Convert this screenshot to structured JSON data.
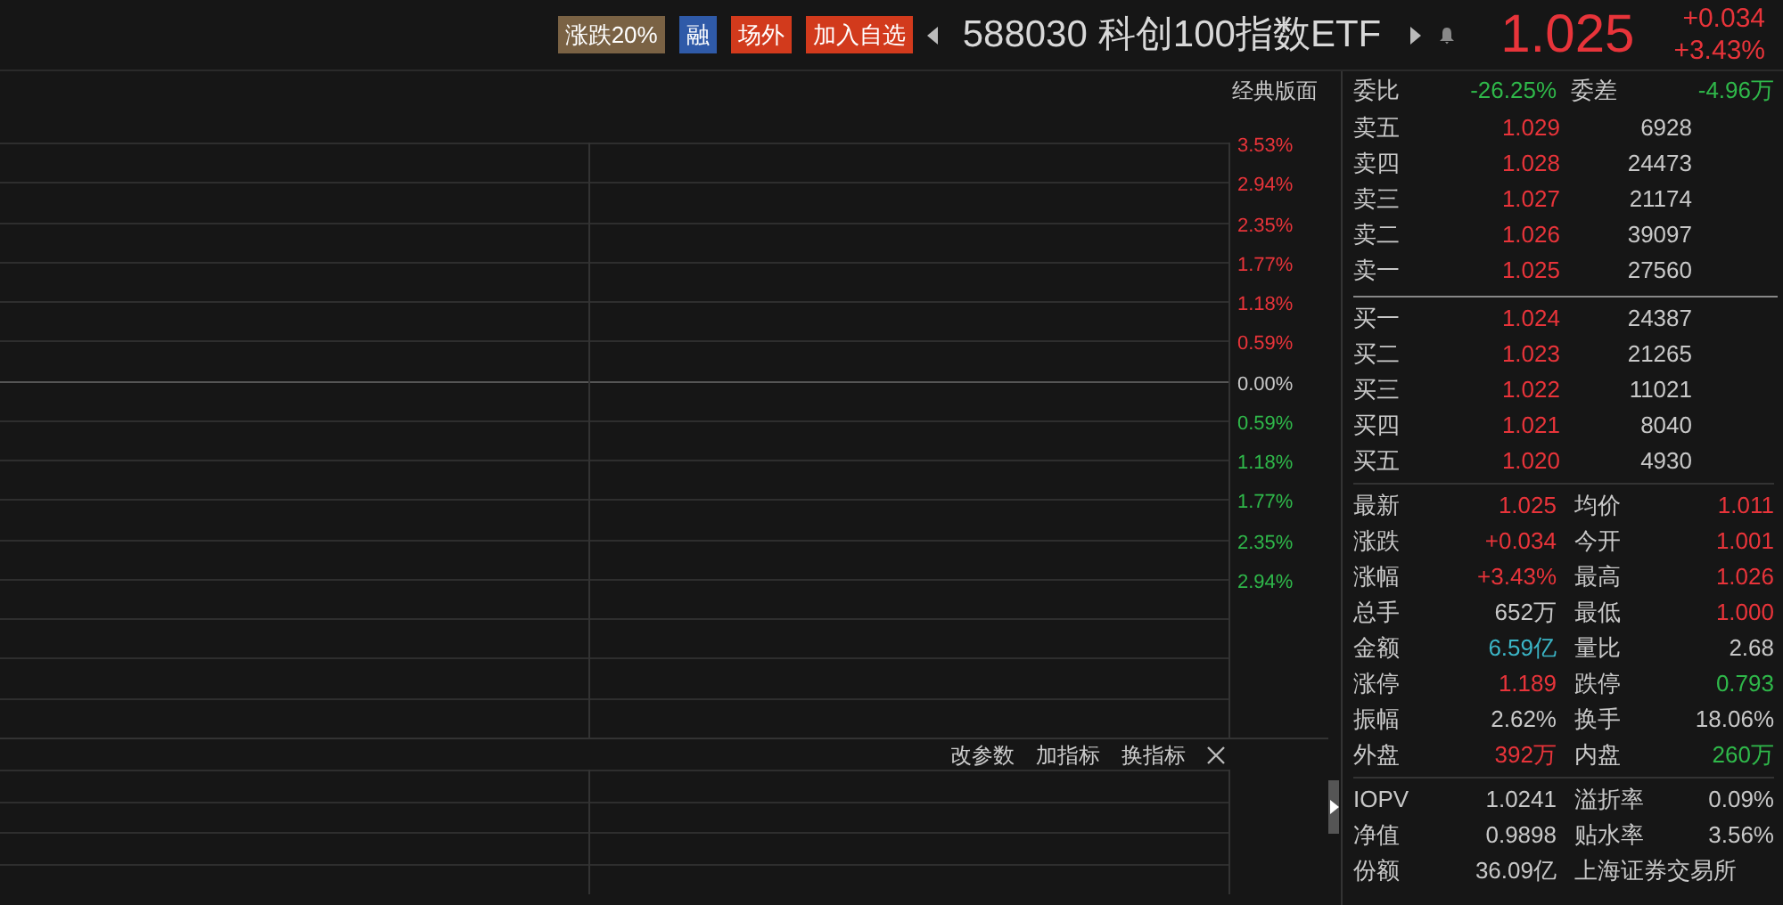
{
  "header": {
    "badges": [
      {
        "text": "涨跌20%",
        "color": "#7a6244"
      },
      {
        "text": "融",
        "color": "#2f5aa8"
      },
      {
        "text": "场外",
        "color": "#d23a1c"
      },
      {
        "text": "加入自选",
        "color": "#d23a1c"
      }
    ],
    "code": "588030",
    "name": "科创100指数ETF",
    "price": "1.025",
    "change": "+0.034",
    "change_pct": "+3.43%"
  },
  "chart": {
    "layout_button": "经典版面",
    "axis_labels": [
      {
        "text": "3.53%",
        "color": "#e8343a"
      },
      {
        "text": "2.94%",
        "color": "#e8343a"
      },
      {
        "text": "2.35%",
        "color": "#e8343a"
      },
      {
        "text": "1.77%",
        "color": "#e8343a"
      },
      {
        "text": "1.18%",
        "color": "#e8343a"
      },
      {
        "text": "0.59%",
        "color": "#e8343a"
      },
      {
        "text": "0.00%",
        "color": "#c8c8c8"
      },
      {
        "text": "0.59%",
        "color": "#2fb84a"
      },
      {
        "text": "1.18%",
        "color": "#2fb84a"
      },
      {
        "text": "1.77%",
        "color": "#2fb84a"
      },
      {
        "text": "2.35%",
        "color": "#2fb84a"
      },
      {
        "text": "2.94%",
        "color": "#2fb84a"
      }
    ],
    "indicator_toolbar": [
      "改参数",
      "加指标",
      "换指标"
    ]
  },
  "order_book": {
    "ratio": {
      "label": "委比",
      "value": "-26.25%",
      "color": "#2fb84a"
    },
    "diff": {
      "label": "委差",
      "value": "-4.96万",
      "color": "#2fb84a"
    },
    "asks": [
      {
        "label": "卖五",
        "price": "1.029",
        "volume": "6928"
      },
      {
        "label": "卖四",
        "price": "1.028",
        "volume": "24473"
      },
      {
        "label": "卖三",
        "price": "1.027",
        "volume": "21174"
      },
      {
        "label": "卖二",
        "price": "1.026",
        "volume": "39097"
      },
      {
        "label": "卖一",
        "price": "1.025",
        "volume": "27560"
      }
    ],
    "bids": [
      {
        "label": "买一",
        "price": "1.024",
        "volume": "24387"
      },
      {
        "label": "买二",
        "price": "1.023",
        "volume": "21265"
      },
      {
        "label": "买三",
        "price": "1.022",
        "volume": "11021"
      },
      {
        "label": "买四",
        "price": "1.021",
        "volume": "8040"
      },
      {
        "label": "买五",
        "price": "1.020",
        "volume": "4930"
      }
    ]
  },
  "stats": [
    [
      {
        "label": "最新",
        "value": "1.025",
        "color": "#e8343a"
      },
      {
        "label": "均价",
        "value": "1.011",
        "color": "#e8343a"
      }
    ],
    [
      {
        "label": "涨跌",
        "value": "+0.034",
        "color": "#e8343a"
      },
      {
        "label": "今开",
        "value": "1.001",
        "color": "#e8343a"
      }
    ],
    [
      {
        "label": "涨幅",
        "value": "+3.43%",
        "color": "#e8343a"
      },
      {
        "label": "最高",
        "value": "1.026",
        "color": "#e8343a"
      }
    ],
    [
      {
        "label": "总手",
        "value": "652万",
        "color": "#c8c8c8"
      },
      {
        "label": "最低",
        "value": "1.000",
        "color": "#e8343a"
      }
    ],
    [
      {
        "label": "金额",
        "value": "6.59亿",
        "color": "#3bb5c6"
      },
      {
        "label": "量比",
        "value": "2.68",
        "color": "#c8c8c8"
      }
    ],
    [
      {
        "label": "涨停",
        "value": "1.189",
        "color": "#e8343a"
      },
      {
        "label": "跌停",
        "value": "0.793",
        "color": "#2fb84a"
      }
    ],
    [
      {
        "label": "振幅",
        "value": "2.62%",
        "color": "#c8c8c8"
      },
      {
        "label": "换手",
        "value": "18.06%",
        "color": "#c8c8c8"
      }
    ],
    [
      {
        "label": "外盘",
        "value": "392万",
        "color": "#e8343a"
      },
      {
        "label": "内盘",
        "value": "260万",
        "color": "#2fb84a"
      }
    ]
  ],
  "etf_stats": [
    [
      {
        "label": "IOPV",
        "value": "1.0241"
      },
      {
        "label": "溢折率",
        "value": "0.09%"
      }
    ],
    [
      {
        "label": "净值",
        "value": "0.9898"
      },
      {
        "label": "贴水率",
        "value": "3.56%"
      }
    ],
    [
      {
        "label": "份额",
        "value": "36.09亿"
      },
      {
        "label": "上海证券交易所"
      }
    ]
  ]
}
